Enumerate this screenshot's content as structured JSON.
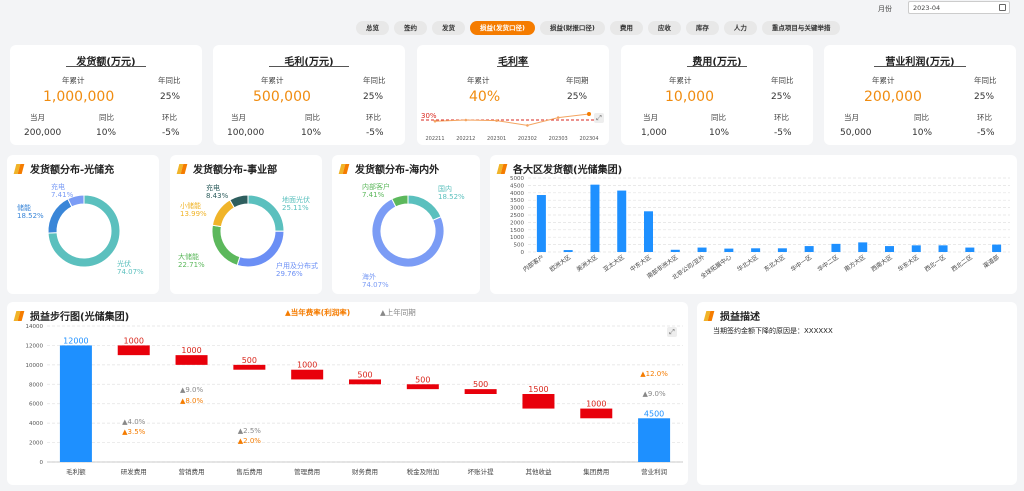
{
  "filter": {
    "month_label": "月份",
    "month_value": "2023-04"
  },
  "tabs": [
    {
      "label": "总览"
    },
    {
      "label": "签约"
    },
    {
      "label": "发货"
    },
    {
      "label": "损益(发货口径)",
      "active": true
    },
    {
      "label": "损益(财报口径)"
    },
    {
      "label": "费用"
    },
    {
      "label": "应收"
    },
    {
      "label": "库存"
    },
    {
      "label": "人力"
    },
    {
      "label": "重点项目与关键举措"
    }
  ],
  "kpis": [
    {
      "title": "发货额(万元)",
      "ytd_label": "年累计",
      "yoy_label": "年同比",
      "ytd": "1,000,000",
      "yoy": "25%",
      "m_label": "当月",
      "m_yoy_label": "同比",
      "m_mom_label": "环比",
      "month": "200,000",
      "m_yoy": "10%",
      "m_mom": "-5%"
    },
    {
      "title": "毛利(万元)",
      "ytd_label": "年累计",
      "yoy_label": "年同比",
      "ytd": "500,000",
      "yoy": "25%",
      "m_label": "当月",
      "m_yoy_label": "同比",
      "m_mom_label": "环比",
      "month": "100,000",
      "m_yoy": "10%",
      "m_mom": "-5%"
    },
    {
      "title": "毛利率",
      "ytd_label": "年累计",
      "yoy_label": "年同期",
      "ytd": "40%",
      "yoy": "25%"
    },
    {
      "title": "费用(万元)",
      "ytd_label": "年累计",
      "yoy_label": "年同比",
      "ytd": "10,000",
      "yoy": "25%",
      "m_label": "当月",
      "m_yoy_label": "同比",
      "m_mom_label": "环比",
      "month": "1,000",
      "m_yoy": "10%",
      "m_mom": "-5%"
    },
    {
      "title": "营业利润(万元)",
      "ytd_label": "年累计",
      "yoy_label": "年同比",
      "ytd": "200,000",
      "yoy": "25%",
      "m_label": "当月",
      "m_yoy_label": "同比",
      "m_mom_label": "环比",
      "month": "50,000",
      "m_yoy": "10%",
      "m_mom": "-5%"
    }
  ],
  "donuts": [
    {
      "title": "发货额分布-光储充",
      "slices": [
        {
          "name": "光伏",
          "pct": "74.07%",
          "value": 74.07,
          "color": "#5bc0be"
        },
        {
          "name": "储能",
          "pct": "18.52%",
          "value": 18.52,
          "color": "#3a86d8"
        },
        {
          "name": "充电",
          "pct": "7.41%",
          "value": 7.41,
          "color": "#7b9cf5"
        }
      ]
    },
    {
      "title": "发货额分布-事业部",
      "slices": [
        {
          "name": "地面光伏",
          "pct": "25.11%",
          "value": 25.11,
          "color": "#5bc0be"
        },
        {
          "name": "户用及分布式",
          "pct": "29.76%",
          "value": 29.76,
          "color": "#6b8ff5"
        },
        {
          "name": "大储能",
          "pct": "22.71%",
          "value": 22.71,
          "color": "#5cb85c"
        },
        {
          "name": "小储能",
          "pct": "13.99%",
          "value": 13.99,
          "color": "#f0b429"
        },
        {
          "name": "充电",
          "pct": "8.43%",
          "value": 8.43,
          "color": "#2e5e5e"
        }
      ]
    },
    {
      "title": "发货额分布-海内外",
      "slices": [
        {
          "name": "国内",
          "pct": "18.52%",
          "value": 18.52,
          "color": "#5bc0be"
        },
        {
          "name": "海外",
          "pct": "74.07%",
          "value": 74.07,
          "color": "#7b9cf5"
        },
        {
          "name": "内部客户",
          "pct": "7.41%",
          "value": 7.41,
          "color": "#5cb85c"
        }
      ]
    }
  ],
  "margin_spark": {
    "ref_label": "30%",
    "x": [
      "202211",
      "202212",
      "202301",
      "202302",
      "202303",
      "202304"
    ],
    "y": [
      28,
      30,
      29,
      21,
      34,
      40
    ]
  },
  "region_chart": {
    "title": "各大区发货额(光储集团)",
    "chart_data": {
      "type": "bar",
      "categories": [
        "内部客户",
        "欧洲大区",
        "美洲大区",
        "亚太大区",
        "中东大区",
        "南部非洲大区",
        "北非公司/亚外",
        "全球拓展中心",
        "华北大区",
        "东北大区",
        "华中一区",
        "华中二区",
        "南方大区",
        "西南大区",
        "华东大区",
        "西北一区",
        "西北二区",
        "渠道部"
      ],
      "values": [
        3850,
        130,
        4550,
        4150,
        2750,
        150,
        300,
        230,
        250,
        250,
        400,
        550,
        650,
        400,
        450,
        450,
        300,
        500
      ],
      "ylim": [
        0,
        5000
      ],
      "yticks": [
        0,
        500,
        1000,
        1500,
        2000,
        2500,
        3000,
        3500,
        4000,
        4500,
        5000
      ]
    }
  },
  "waterfall": {
    "title": "损益步行图(光储集团)",
    "legend_current": "▲当年费率(利润率)",
    "legend_prev": "▲上年同期",
    "chart_data": {
      "type": "bar",
      "categories": [
        "毛利额",
        "研发费用",
        "营销费用",
        "售后费用",
        "管理费用",
        "财务费用",
        "税金及附加",
        "坏账计提",
        "其他收益",
        "集团费用",
        "营业利润"
      ],
      "values": [
        12000,
        1000,
        1000,
        500,
        1000,
        500,
        500,
        500,
        1500,
        1000,
        4500
      ],
      "labels": [
        "12000",
        "1000",
        "1000",
        "500",
        "1000",
        "500",
        "500",
        "500",
        "1500",
        "1000",
        "4500"
      ],
      "ylim": [
        0,
        14000
      ],
      "yticks": [
        0,
        2000,
        4000,
        6000,
        8000,
        10000,
        12000,
        14000
      ],
      "rates": [
        {
          "index": 1,
          "prev": "4.0%",
          "cur": "3.5%"
        },
        {
          "index": 2,
          "prev": "9.0%",
          "cur": "8.0%"
        },
        {
          "index": 3,
          "prev": "2.5%",
          "cur": "2.0%"
        },
        {
          "index": 10,
          "prev": "9.0%",
          "cur": "12.0%"
        }
      ]
    }
  },
  "description": {
    "title": "损益描述",
    "text": "当期签约金额下降的原因是：XXXXXX"
  },
  "colors": {
    "accent": "#f57c00",
    "total_bar": "#1e90ff",
    "decrease_bar": "#e8000b",
    "region_bar": "#1e90ff"
  }
}
